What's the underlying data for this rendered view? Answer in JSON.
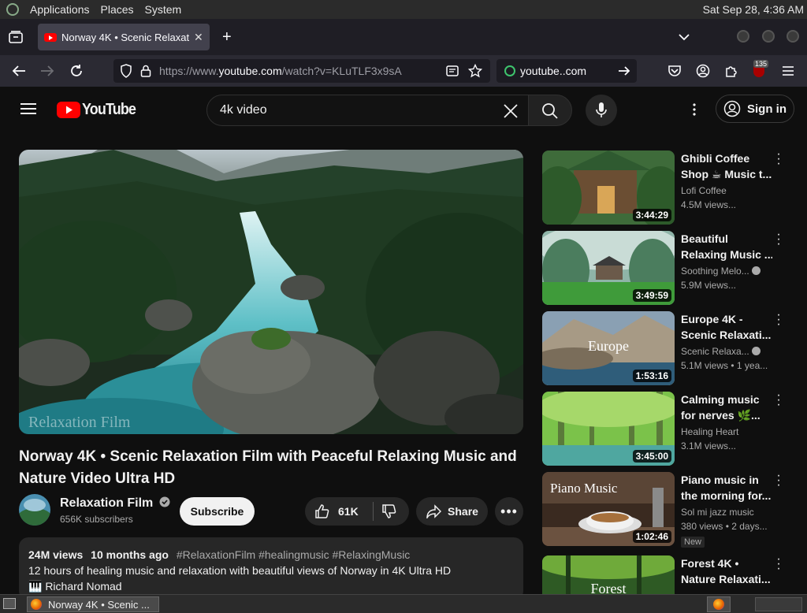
{
  "system_bar": {
    "menu": [
      "Applications",
      "Places",
      "System"
    ],
    "clock": "Sat Sep 28,  4:36 AM"
  },
  "browser": {
    "tab_title": "Norway 4K • Scenic Relaxati",
    "new_tab": "+",
    "url_prefix": "https://www.",
    "url_host": "youtube.com",
    "url_path": "/watch?v=KLuTLF3x9sA",
    "search_field": "youtube..com",
    "extension_badge": "135"
  },
  "youtube": {
    "logo_text": "YouTube",
    "search_value": "4k video",
    "sign_in": "Sign in"
  },
  "video": {
    "title_line1": "Norway 4K • Scenic Relaxation Film with Peaceful Relaxing Music and",
    "title_line2": "Nature Video Ultra HD",
    "watermark": "Relaxation Film",
    "channel_name": "Relaxation Film",
    "subscribers": "656K subscribers",
    "subscribe": "Subscribe",
    "likes": "61K",
    "share": "Share",
    "views": "24M views",
    "age": "10 months ago",
    "tags": "#RelaxationFilm #healingmusic #RelaxingMusic",
    "description": "12 hours of healing music and relaxation with beautiful views of Norway in 4K Ultra HD",
    "credit": "🎹 Richard Nomad"
  },
  "recommendations": [
    {
      "title1": "Ghibli Coffee",
      "title2": "Shop ☕ Music t...",
      "channel": "Lofi Coffee",
      "views": "4.5M views...",
      "duration": "3:44:29",
      "overlay": ""
    },
    {
      "title1": "Beautiful",
      "title2": "Relaxing Music ...",
      "channel": "Soothing Melo...",
      "views": "5.9M views...",
      "duration": "3:49:59",
      "overlay": ""
    },
    {
      "title1": "Europe 4K -",
      "title2": "Scenic Relaxati...",
      "channel": "Scenic Relaxa...",
      "views": "5.1M views  • 1 yea...",
      "duration": "1:53:16",
      "overlay": "Europe"
    },
    {
      "title1": "Calming music",
      "title2": "for nerves 🌿...",
      "channel": "Healing Heart",
      "views": "3.1M views...",
      "duration": "3:45:00",
      "overlay": ""
    },
    {
      "title1": "Piano music in",
      "title2": "the morning for...",
      "channel": "Sol mi jazz music",
      "views": "380 views  • 2 days...",
      "duration": "1:02:46",
      "overlay": "Piano Music",
      "badge": "New"
    },
    {
      "title1": "Forest 4K •",
      "title2": "Nature Relaxati...",
      "channel": "",
      "views": "",
      "duration": "",
      "overlay": "Forest"
    }
  ],
  "taskbar": {
    "window": "Norway 4K • Scenic ..."
  },
  "colors": {
    "yt_red": "#ff0000",
    "background": "#0f0f0f",
    "chip": "#272727"
  }
}
